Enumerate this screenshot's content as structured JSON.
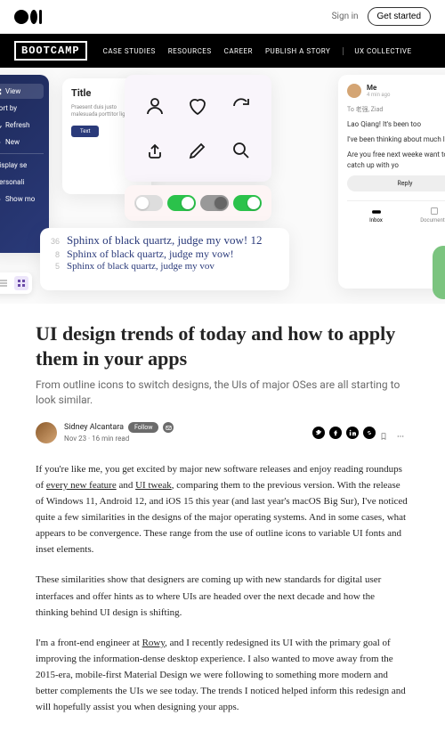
{
  "topbar": {
    "signin": "Sign in",
    "getstarted": "Get started"
  },
  "pub": {
    "logo": "BOOTCAMP",
    "nav": [
      "CASE STUDIES",
      "RESOURCES",
      "CAREER",
      "PUBLISH A STORY",
      "UX COLLECTIVE"
    ]
  },
  "hero": {
    "blue_menu": [
      "View",
      "Sort by",
      "Refresh",
      "New",
      "Display se",
      "Personali",
      "Show mo"
    ],
    "title_card": {
      "heading": "Title",
      "body": "Praesent duis justo malesuada porttitor ligula, eg",
      "btn": "Text"
    },
    "sample_text": {
      "lines": [
        {
          "n": "36",
          "t": "Sphinx of black quartz, judge my vow! 12"
        },
        {
          "n": "8",
          "t": "Sphinx of black quartz, judge my vow!"
        },
        {
          "n": "5",
          "t": "Sphinx of black quartz, judge my vov"
        }
      ]
    },
    "chat": {
      "name": "Me",
      "time": "4 min ago",
      "to": "To 老强, Ziad",
      "m1": "Lao Qiang! It's been too",
      "m2": "I've been thinking about much lately.",
      "m3": "Are you free next weeke want to catch up with yo",
      "reply": "Reply",
      "tab1": "Inbox",
      "tab2": "Documents"
    }
  },
  "article": {
    "title": "UI design trends of today and how to apply them in your apps",
    "subtitle": "From outline icons to switch designs, the UIs of major OSes are all starting to look similar.",
    "author": "Sidney Alcantara",
    "follow": "Follow",
    "meta": "Nov 23 · 16 min read",
    "p1_a": "If you're like me, you get excited by major new software releases and enjoy reading roundups of ",
    "p1_l1": "every new feature",
    "p1_b": " and ",
    "p1_l2": "UI tweak",
    "p1_c": ", comparing them to the previous version. With the release of Windows 11, Android 12, and iOS 15 this year (and last year's macOS Big Sur), I've noticed quite a few similarities in the designs of the major operating systems. And in some cases, what appears to be convergence. These range from the use of outline icons to variable UI fonts and inset elements.",
    "p2": "These similarities show that designers are coming up with new standards for digital user interfaces and offer hints as to where UIs are headed over the next decade and how the thinking behind UI design is shifting.",
    "p3_a": "I'm a front-end engineer at ",
    "p3_l": "Rowy",
    "p3_b": ", and I recently redesigned its UI with the primary goal of improving the information-dense desktop experience. I also wanted to move away from the 2015-era, mobile-first Material Design we were following to something more modern and better complements the UIs we see today. The trends I noticed helped inform this redesign and will hopefully assist you when designing your apps."
  }
}
